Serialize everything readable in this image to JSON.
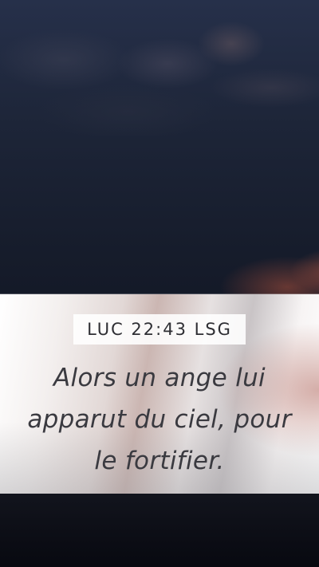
{
  "wallpaper": {
    "reference": "LUC 22:43 LSG",
    "verse": "Alors un ange lui apparut du ciel, pour le fortifier.",
    "colors": {
      "sky_top": "#26304a",
      "sky_bottom": "#090b13",
      "band_light": "#ffffff",
      "text_color": "#3a3a40",
      "glow_accent": "#c85f46"
    }
  }
}
